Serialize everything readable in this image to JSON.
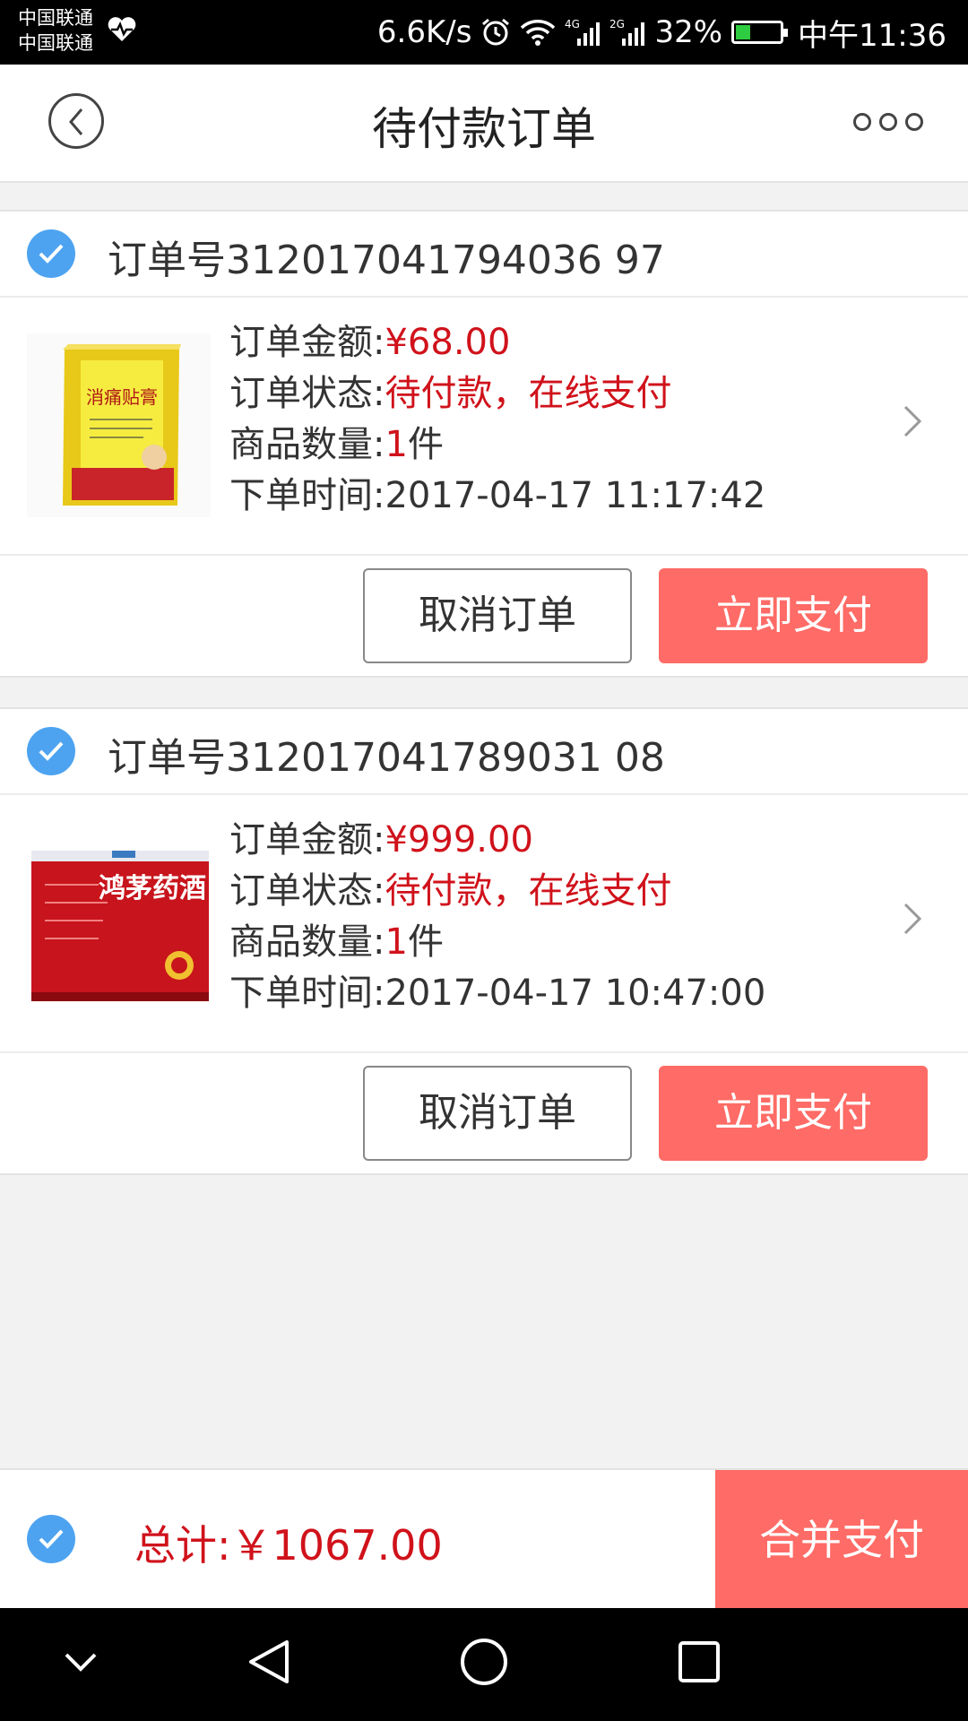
{
  "status_bar": {
    "carrier1": "中国联通",
    "carrier2": "中国联通",
    "speed": "6.6K/s",
    "battery": "32%",
    "time": "中午11:36",
    "battery_level": 0.32,
    "icons": [
      "heart-rate-icon",
      "alarm-icon",
      "wifi-icon",
      "signal-4g-icon",
      "signal-2g-icon",
      "battery-icon"
    ]
  },
  "header": {
    "title": "待付款订单",
    "back_icon": "back-arrow-icon",
    "more_icon": "more-dots-icon"
  },
  "orders": [
    {
      "order_no": "订单号312017041794036 97",
      "amount_label": "订单金额:",
      "amount": "¥68.00",
      "status_label": "订单状态:",
      "status": "待付款，在线支付",
      "qty_label": "商品数量:",
      "qty": "1",
      "qty_unit": "件",
      "time_label": "下单时间:",
      "time": "2017-04-17 11:17:42",
      "product_name": "消痛贴膏",
      "cancel_label": "取消订单",
      "pay_label": "立即支付"
    },
    {
      "order_no": "订单号312017041789031 08",
      "amount_label": "订单金额:",
      "amount": "¥999.00",
      "status_label": "订单状态:",
      "status": "待付款，在线支付",
      "qty_label": "商品数量:",
      "qty": "1",
      "qty_unit": "件",
      "time_label": "下单时间:",
      "time": "2017-04-17 10:47:00",
      "product_name": "鸿茅药酒",
      "cancel_label": "取消订单",
      "pay_label": "立即支付"
    }
  ],
  "footer": {
    "total": "总计:￥1067.00",
    "merge_pay": "合并支付"
  },
  "colors": {
    "accent_red": "#ff6b66",
    "price_red": "#d0121b",
    "check_blue": "#4da3f0"
  }
}
